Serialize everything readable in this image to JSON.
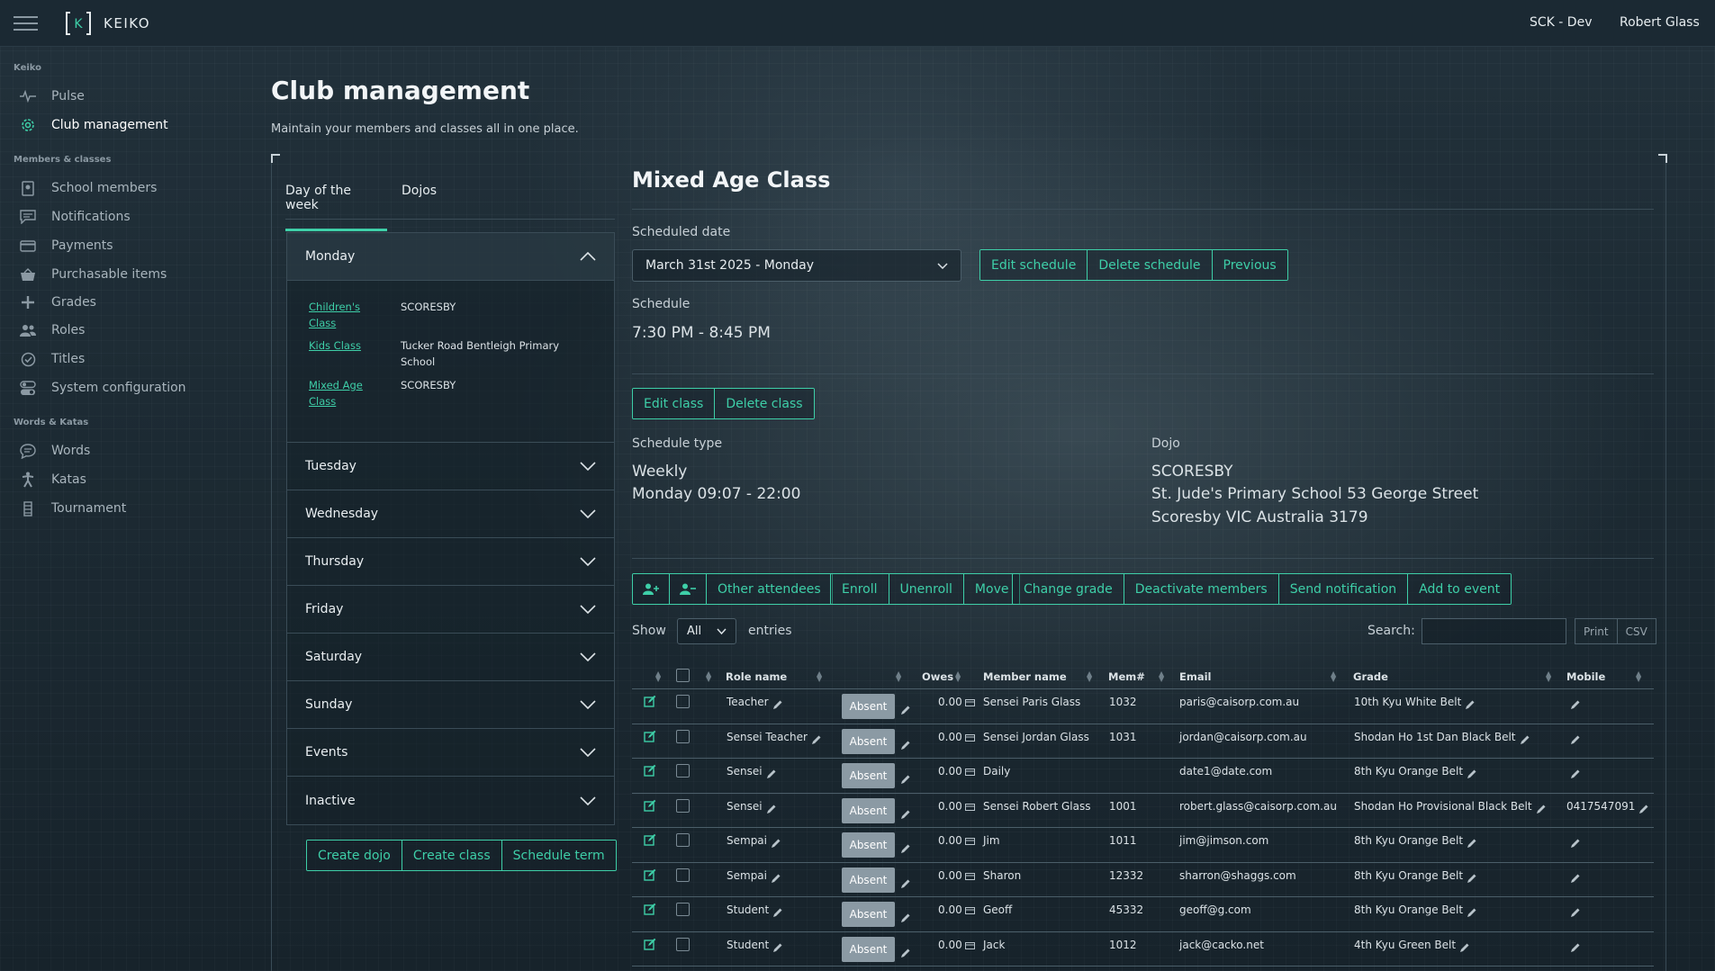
{
  "app": {
    "brand": "KEIKO",
    "logo_letter": "K",
    "environment": "SCK - Dev",
    "user_name": "Robert Glass"
  },
  "sidebar": {
    "sections": {
      "keiko": "Keiko",
      "members": "Members & classes",
      "words": "Words & Katas"
    },
    "items": [
      {
        "label": "Pulse",
        "icon": "pulse-icon"
      },
      {
        "label": "Club management",
        "icon": "gear-icon",
        "active": true
      },
      {
        "label": "School members",
        "icon": "member-card-icon"
      },
      {
        "label": "Notifications",
        "icon": "chat-icon"
      },
      {
        "label": "Payments",
        "icon": "credit-card-icon"
      },
      {
        "label": "Purchasable items",
        "icon": "basket-icon"
      },
      {
        "label": "Grades",
        "icon": "plus-icon"
      },
      {
        "label": "Roles",
        "icon": "users-icon"
      },
      {
        "label": "Titles",
        "icon": "check-circle-icon"
      },
      {
        "label": "System configuration",
        "icon": "toggles-icon"
      },
      {
        "label": "Words",
        "icon": "speech-icon"
      },
      {
        "label": "Katas",
        "icon": "figure-icon"
      },
      {
        "label": "Tournament",
        "icon": "bracket-icon"
      }
    ]
  },
  "page": {
    "title": "Club management",
    "subtitle": "Maintain your members and classes all in one place."
  },
  "left": {
    "tabs": [
      "Day of the week",
      "Dojos"
    ],
    "days": [
      "Monday",
      "Tuesday",
      "Wednesday",
      "Thursday",
      "Friday",
      "Saturday",
      "Sunday",
      "Events",
      "Inactive"
    ],
    "monday_classes": [
      {
        "name": "Children's Class",
        "dojo": "SCORESBY"
      },
      {
        "name": "Kids Class",
        "dojo": "Tucker Road Bentleigh Primary School"
      },
      {
        "name": "Mixed Age Class",
        "dojo": "SCORESBY"
      }
    ],
    "buttons": [
      "Create dojo",
      "Create class",
      "Schedule term"
    ]
  },
  "class": {
    "title": "Mixed Age Class",
    "scheduled_date_label": "Scheduled date",
    "scheduled_date": "March 31st 2025 - Monday",
    "schedule_buttons": [
      "Edit schedule",
      "Delete schedule",
      "Previous"
    ],
    "schedule_label": "Schedule",
    "schedule": "7:30 PM - 8:45 PM",
    "class_buttons": [
      "Edit class",
      "Delete class"
    ],
    "schedule_type_label": "Schedule type",
    "schedule_type": "Weekly",
    "schedule_time": "Monday 09:07 - 22:00",
    "dojo_label": "Dojo",
    "dojo_name": "SCORESBY",
    "dojo_address1": "St. Jude's Primary School 53 George Street",
    "dojo_address2": "Scoresby VIC Australia 3179",
    "action_buttons": [
      "Other attendees",
      "Enroll",
      "Unenroll",
      "Move",
      "Change grade",
      "Deactivate members",
      "Send notification",
      "Add to event"
    ]
  },
  "table": {
    "show_label": "Show",
    "show_value": "All",
    "entries_label": "entries",
    "search_label": "Search:",
    "search_value": "",
    "print_label": "Print",
    "csv_label": "CSV",
    "headers": {
      "role": "Role name",
      "owes": "Owes",
      "member": "Member name",
      "mem": "Mem#",
      "email": "Email",
      "grade": "Grade",
      "mobile": "Mobile"
    },
    "absent_label": "Absent",
    "rows": [
      {
        "role": "Teacher",
        "owes": "0.00",
        "member": "Sensei Paris Glass",
        "mem": "1032",
        "email": "paris@caisorp.com.au",
        "grade": "10th Kyu White Belt",
        "mobile": ""
      },
      {
        "role": "Sensei Teacher",
        "owes": "0.00",
        "member": "Sensei Jordan Glass",
        "mem": "1031",
        "email": "jordan@caisorp.com.au",
        "grade": "Shodan Ho 1st Dan Black Belt",
        "mobile": ""
      },
      {
        "role": "Sensei",
        "owes": "0.00",
        "member": "Daily",
        "mem": "",
        "email": "date1@date.com",
        "grade": "8th Kyu Orange Belt",
        "mobile": ""
      },
      {
        "role": "Sensei",
        "owes": "0.00",
        "member": "Sensei Robert Glass",
        "mem": "1001",
        "email": "robert.glass@caisorp.com.au",
        "grade": "Shodan Ho Provisional Black Belt",
        "mobile": "0417547091"
      },
      {
        "role": "Sempai",
        "owes": "0.00",
        "member": "Jim",
        "mem": "1011",
        "email": "jim@jimson.com",
        "grade": "8th Kyu Orange Belt",
        "mobile": ""
      },
      {
        "role": "Sempai",
        "owes": "0.00",
        "member": "Sharon",
        "mem": "12332",
        "email": "sharron@shaggs.com",
        "grade": "8th Kyu Orange Belt",
        "mobile": ""
      },
      {
        "role": "Student",
        "owes": "0.00",
        "member": "Geoff",
        "mem": "45332",
        "email": "geoff@g.com",
        "grade": "8th Kyu Orange Belt",
        "mobile": ""
      },
      {
        "role": "Student",
        "owes": "0.00",
        "member": "Jack",
        "mem": "1012",
        "email": "jack@cacko.net",
        "grade": "4th Kyu Green Belt",
        "mobile": ""
      }
    ]
  },
  "colors": {
    "accent": "#3ecfa8",
    "background": "#1d2b34",
    "absent_button": "#8b9aa4"
  }
}
